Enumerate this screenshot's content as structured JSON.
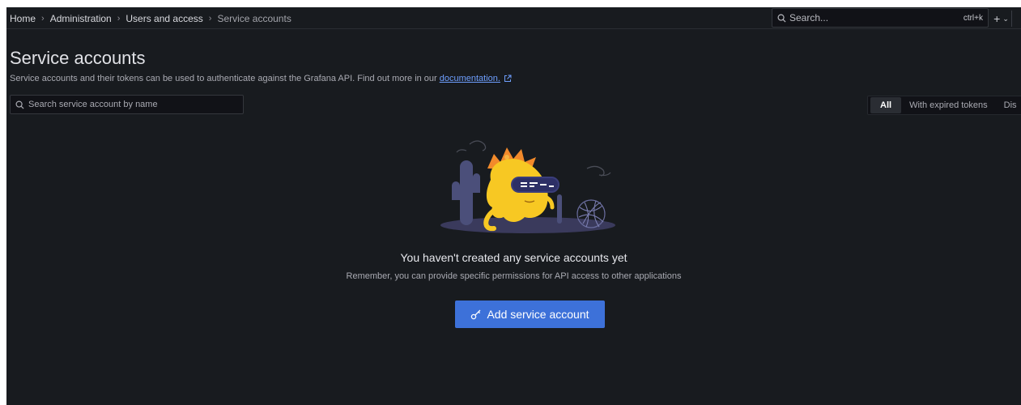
{
  "breadcrumb": {
    "items": [
      "Home",
      "Administration",
      "Users and access"
    ],
    "current": "Service accounts"
  },
  "global_search": {
    "placeholder": "Search...",
    "shortcut": "ctrl+k"
  },
  "new_menu": {
    "label": "+"
  },
  "page": {
    "title": "Service accounts",
    "description": "Service accounts and their tokens can be used to authenticate against the Grafana API. Find out more in our",
    "doc_link": "documentation."
  },
  "filter": {
    "search_placeholder": "Search service account by name",
    "options": [
      "All",
      "With expired tokens",
      "Dis"
    ],
    "selected": "All"
  },
  "empty_state": {
    "title": "You haven't created any service accounts yet",
    "subtitle": "Remember, you can provide specific permissions for API access to other applications",
    "button_label": "Add service account"
  },
  "icons": {
    "search": "search-icon",
    "external_link": "external-link-icon",
    "key": "key-icon",
    "chevron": "chevron-down-icon"
  },
  "colors": {
    "background": "#181b1f",
    "primary_button": "#3d71d9",
    "link": "#6e9fff"
  }
}
